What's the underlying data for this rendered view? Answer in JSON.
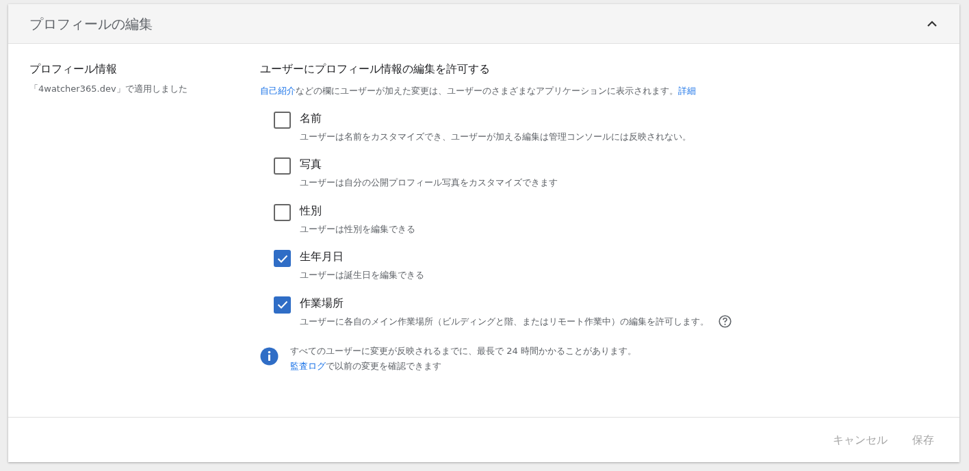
{
  "panel": {
    "title": "プロフィールの編集",
    "expanded": true
  },
  "section": {
    "title": "プロフィール情報",
    "subtitle": "「4watcher365.dev」で適用しました"
  },
  "setting": {
    "title": "ユーザーにプロフィール情報の編集を許可する",
    "description": [
      {
        "kind": "link",
        "text": "自己紹介"
      },
      {
        "kind": "text",
        "text": "などの欄にユーザーが加えた変更は、ユーザーのさまざまなアプリケーションに表示されます。"
      },
      {
        "kind": "link",
        "text": "詳細"
      }
    ],
    "options": [
      {
        "label": "名前",
        "description": "ユーザーは名前をカスタマイズでき、ユーザーが加える編集は管理コンソールには反映されない。",
        "checked": false,
        "help": false
      },
      {
        "label": "写真",
        "description": "ユーザーは自分の公開プロフィール写真をカスタマイズできます",
        "checked": false,
        "help": false
      },
      {
        "label": "性別",
        "description": "ユーザーは性別を編集できる",
        "checked": false,
        "help": false
      },
      {
        "label": "生年月日",
        "description": "ユーザーは誕生日を編集できる",
        "checked": true,
        "help": false
      },
      {
        "label": "作業場所",
        "description": "ユーザーに各自のメイン作業場所（ビルディングと階、またはリモート作業中）の編集を許可します。",
        "checked": true,
        "help": true
      }
    ],
    "notice": {
      "line_1": "すべてのユーザーに変更が反映されるまでに、最長で 24 時間かかることがあります。",
      "line_2": [
        {
          "kind": "link",
          "text": "監査ログ"
        },
        {
          "kind": "text",
          "text": "で以前の変更を確認できます"
        }
      ]
    }
  },
  "buttons": [
    {
      "label": "キャンセル",
      "disabled": true
    },
    {
      "label": "保存",
      "disabled": true
    }
  ]
}
